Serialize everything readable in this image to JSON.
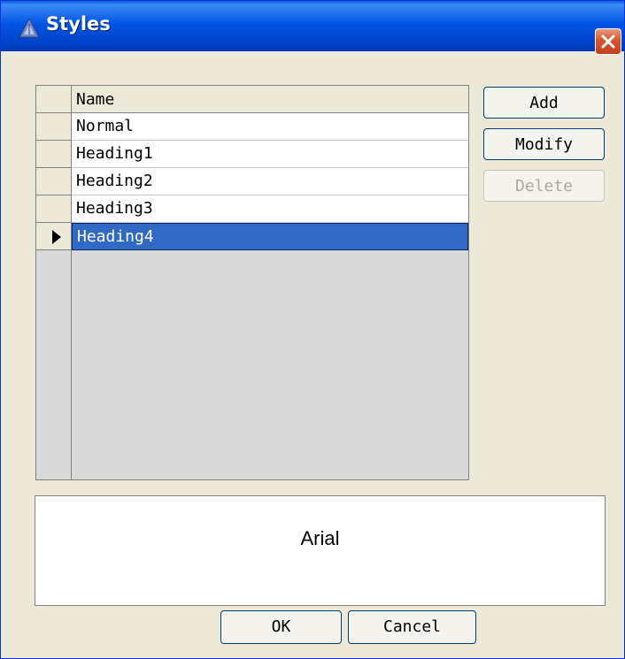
{
  "window": {
    "title": "Styles",
    "app_icon": "styles-app-icon",
    "close_icon": "close-icon"
  },
  "grid": {
    "column_header": "Name",
    "rows": [
      {
        "name": "Normal"
      },
      {
        "name": "Heading1"
      },
      {
        "name": "Heading2"
      },
      {
        "name": "Heading3"
      },
      {
        "name": "Heading4"
      }
    ],
    "selected_row": "Heading4",
    "row_pointer_icon": "row-pointer-icon"
  },
  "side_buttons": {
    "add": "Add",
    "modify": "Modify",
    "delete": "Delete"
  },
  "preview": {
    "font_name": "Arial"
  },
  "footer": {
    "ok": "OK",
    "cancel": "Cancel"
  },
  "colors": {
    "titlebar": "#0055e5",
    "selection": "#316ac5",
    "dialog_bg": "#ece9d8",
    "close_button": "#d7542d"
  }
}
